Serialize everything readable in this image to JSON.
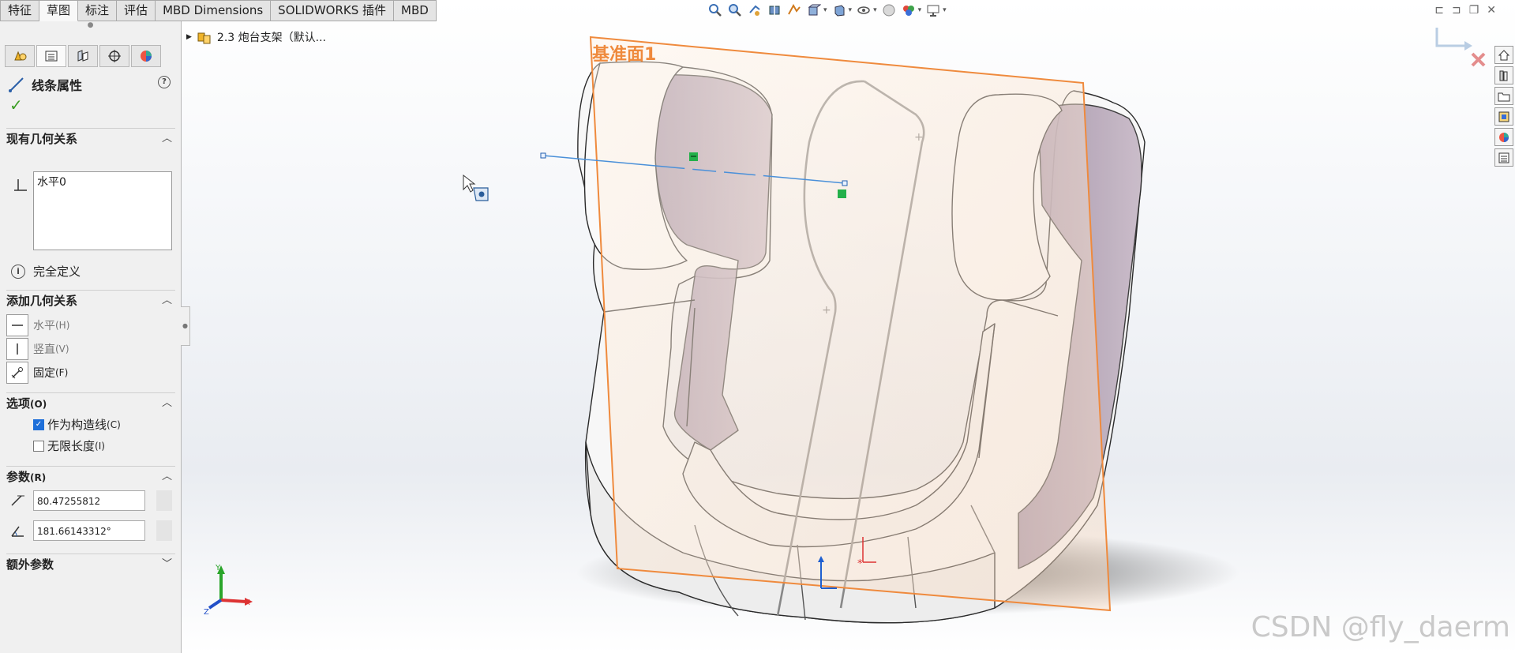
{
  "tabs": [
    "特征",
    "草图",
    "标注",
    "评估",
    "MBD Dimensions",
    "SOLIDWORKS 插件",
    "MBD"
  ],
  "active_tab_index": 1,
  "view_toolbar_icons": [
    "zoom-to-fit-icon",
    "zoom-area-icon",
    "previous-view-icon",
    "section-view-icon",
    "dynamic-annotation-icon",
    "view-orientation-icon",
    "display-style-icon",
    "hide-show-items-icon",
    "edit-appearance-icon",
    "apply-scene-icon",
    "view-settings-icon"
  ],
  "tree": {
    "item": "2.3 炮台支架（默认..."
  },
  "property_manager": {
    "title": "线条属性",
    "existing_relations": {
      "header": "现有几何关系",
      "items": [
        "水平0"
      ]
    },
    "status": "完全定义",
    "add_relations": {
      "header": "添加几何关系",
      "items": [
        {
          "label": "水平",
          "hotkey": "(H)",
          "enabled": false
        },
        {
          "label": "竖直",
          "hotkey": "(V)",
          "enabled": false
        },
        {
          "label": "固定",
          "hotkey": "(F)",
          "enabled": true
        }
      ]
    },
    "options": {
      "header": "选项",
      "hotkey": "(O)",
      "items": [
        {
          "label": "作为构造线",
          "hotkey": "(C)",
          "checked": true
        },
        {
          "label": "无限长度",
          "hotkey": "(I)",
          "checked": false
        }
      ]
    },
    "parameters": {
      "header": "参数",
      "hotkey": "(R)",
      "length": "80.47255812",
      "angle": "181.66143312°"
    },
    "extra": {
      "header": "额外参数"
    }
  },
  "plane_label": "基准面1",
  "triad": {
    "x": "X",
    "y": "Y",
    "z": "Z"
  },
  "watermark": "CSDN @fly_daerm",
  "colors": {
    "plane": "#ef8a3d",
    "sketch_line": "#4a90d9",
    "accent": "#1e6fd9"
  }
}
